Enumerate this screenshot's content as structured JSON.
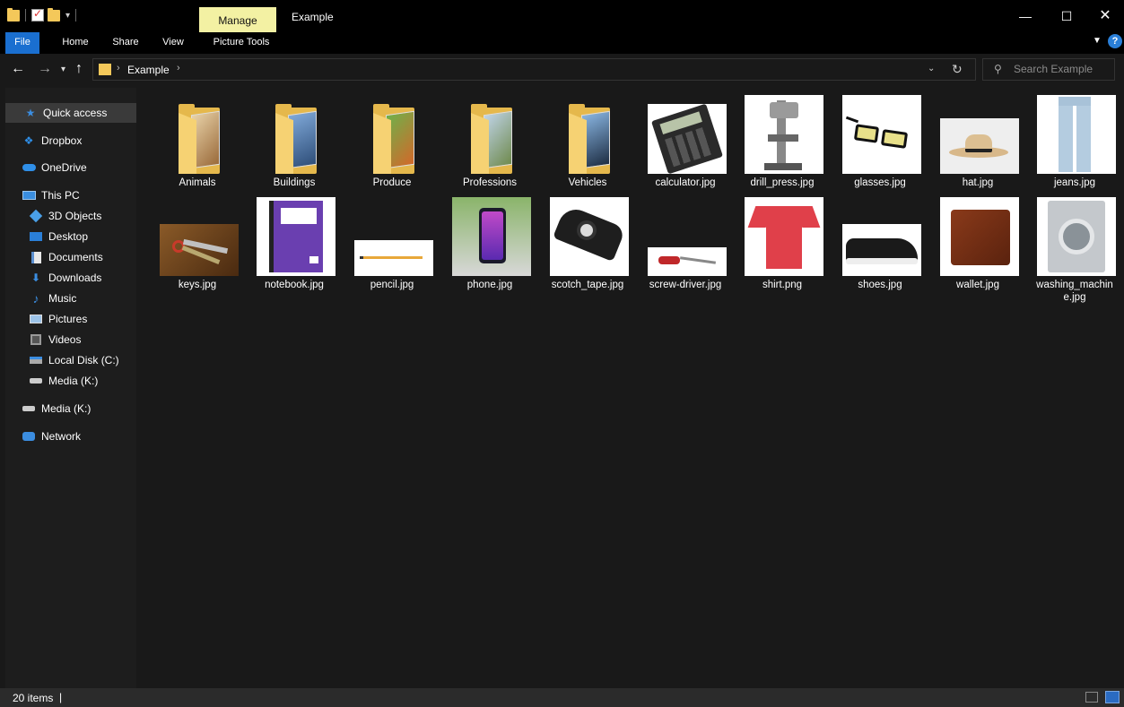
{
  "window": {
    "title": "Example",
    "contextual_tab": "Manage"
  },
  "window_controls": {
    "minimize": "—",
    "maximize": "☐",
    "close": "✕"
  },
  "ribbon": {
    "tabs": [
      "File",
      "Home",
      "Share",
      "View",
      "Picture Tools"
    ],
    "help": "?"
  },
  "address": {
    "path": "Example"
  },
  "search": {
    "placeholder": "Search Example"
  },
  "sidebar": {
    "items": [
      {
        "label": "Quick access",
        "icon": "star-icon"
      },
      {
        "label": "Dropbox",
        "icon": "dropbox-icon"
      },
      {
        "label": "OneDrive",
        "icon": "cloud-icon"
      },
      {
        "label": "This PC",
        "icon": "computer-icon"
      },
      {
        "label": "3D Objects",
        "icon": "cube-icon"
      },
      {
        "label": "Desktop",
        "icon": "desktop-icon"
      },
      {
        "label": "Documents",
        "icon": "documents-icon"
      },
      {
        "label": "Downloads",
        "icon": "download-icon"
      },
      {
        "label": "Music",
        "icon": "music-icon"
      },
      {
        "label": "Pictures",
        "icon": "pictures-icon"
      },
      {
        "label": "Videos",
        "icon": "videos-icon"
      },
      {
        "label": "Local Disk (C:)",
        "icon": "disk-icon"
      },
      {
        "label": "Media (K:)",
        "icon": "drive-icon"
      },
      {
        "label": "Media (K:)",
        "icon": "drive-icon"
      },
      {
        "label": "Network",
        "icon": "network-icon"
      }
    ]
  },
  "files": [
    {
      "name": "Animals",
      "kind": "folder",
      "color": "#c8a070"
    },
    {
      "name": "Buildings",
      "kind": "folder",
      "color": "#4a6fa8"
    },
    {
      "name": "Produce",
      "kind": "folder",
      "color": "#4f8a3a"
    },
    {
      "name": "Professions",
      "kind": "folder",
      "color": "#8fae7a"
    },
    {
      "name": "Vehicles",
      "kind": "folder",
      "color": "#3b5f88"
    },
    {
      "name": "calculator.jpg",
      "kind": "image",
      "icon": "calculator-icon"
    },
    {
      "name": "drill_press.jpg",
      "kind": "image",
      "icon": "drill-press-icon"
    },
    {
      "name": "glasses.jpg",
      "kind": "image",
      "icon": "glasses-icon"
    },
    {
      "name": "hat.jpg",
      "kind": "image",
      "icon": "hat-icon"
    },
    {
      "name": "jeans.jpg",
      "kind": "image",
      "icon": "jeans-icon"
    },
    {
      "name": "keys.jpg",
      "kind": "image",
      "icon": "keys-icon"
    },
    {
      "name": "notebook.jpg",
      "kind": "image",
      "icon": "notebook-icon"
    },
    {
      "name": "pencil.jpg",
      "kind": "image",
      "icon": "pencil-icon"
    },
    {
      "name": "phone.jpg",
      "kind": "image",
      "icon": "phone-icon"
    },
    {
      "name": "scotch_tape.jpg",
      "kind": "image",
      "icon": "tape-icon"
    },
    {
      "name": "screw-driver.jpg",
      "kind": "image",
      "icon": "screwdriver-icon"
    },
    {
      "name": "shirt.png",
      "kind": "image",
      "icon": "shirt-icon"
    },
    {
      "name": "shoes.jpg",
      "kind": "image",
      "icon": "shoes-icon"
    },
    {
      "name": "wallet.jpg",
      "kind": "image",
      "icon": "wallet-icon"
    },
    {
      "name": "washing_machin\ne.jpg",
      "kind": "image",
      "icon": "washing-machine-icon"
    }
  ],
  "status": {
    "count": "20 items",
    "separator": "|"
  }
}
